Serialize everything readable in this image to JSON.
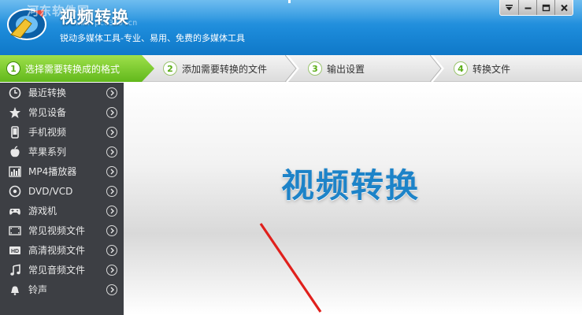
{
  "header": {
    "title": "视频转换",
    "subtitle": "锐动多媒体工具-专业、易用、免费的多媒体工具",
    "watermark_text": "河东软件园",
    "watermark_url": "www.pc0359.cn"
  },
  "window_controls": [
    "menu",
    "minimize",
    "maximize",
    "close"
  ],
  "steps": [
    {
      "num": "1",
      "label": "选择需要转换成的格式",
      "active": true
    },
    {
      "num": "2",
      "label": "添加需要转换的文件",
      "active": false
    },
    {
      "num": "3",
      "label": "输出设置",
      "active": false
    },
    {
      "num": "4",
      "label": "转换文件",
      "active": false
    }
  ],
  "sidebar": {
    "items": [
      {
        "label": "最近转换",
        "icon": "clock-icon"
      },
      {
        "label": "常见设备",
        "icon": "star-icon"
      },
      {
        "label": "手机视频",
        "icon": "phone-icon"
      },
      {
        "label": "苹果系列",
        "icon": "apple-icon"
      },
      {
        "label": "MP4播放器",
        "icon": "mp4-player-icon"
      },
      {
        "label": "DVD/VCD",
        "icon": "disc-icon"
      },
      {
        "label": "游戏机",
        "icon": "gamepad-icon"
      },
      {
        "label": "常见视频文件",
        "icon": "film-icon"
      },
      {
        "label": "高清视频文件",
        "icon": "hd-icon"
      },
      {
        "label": "常见音频文件",
        "icon": "music-icon"
      },
      {
        "label": "铃声",
        "icon": "bell-icon"
      }
    ]
  },
  "main": {
    "banner_title": "视频转换"
  },
  "colors": {
    "header_blue": "#1c8ad9",
    "active_step_green": "#62b81c",
    "sidebar_bg": "#3d3f44",
    "banner_blue": "#1d83c8",
    "annotation_red": "#e0201c"
  }
}
